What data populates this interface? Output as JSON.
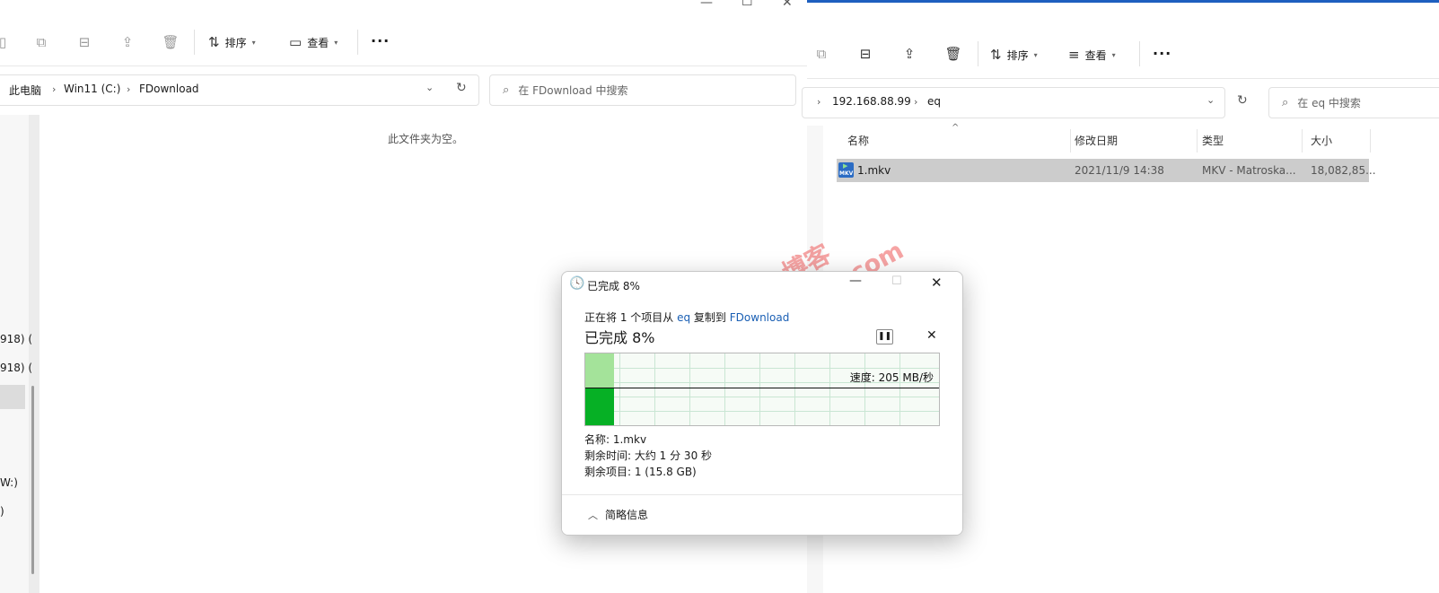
{
  "left_explorer": {
    "toolbar": {
      "sort_label": "排序",
      "view_label": "查看",
      "more_label": "···"
    },
    "address": {
      "segments": [
        "此电脑",
        "Win11 (C:)",
        "FDownload"
      ]
    },
    "search": {
      "placeholder": "在 FDownload 中搜索"
    },
    "empty_message": "此文件夹为空。",
    "nav_fragments": [
      "918) (",
      "918) (",
      "W:)",
      ")"
    ]
  },
  "right_explorer": {
    "toolbar": {
      "sort_label": "排序",
      "view_label": "查看",
      "more_label": "···"
    },
    "address": {
      "segments": [
        "192.168.88.99",
        "eq"
      ]
    },
    "search": {
      "placeholder": "在 eq 中搜索"
    },
    "columns": [
      "名称",
      "修改日期",
      "类型",
      "大小"
    ],
    "files": [
      {
        "name": "1.mkv",
        "modified": "2021/11/9 14:38",
        "type": "MKV - Matroska...",
        "size": "18,082,85...",
        "icon_label": "MKV"
      }
    ]
  },
  "copy_dialog": {
    "title": "已完成 8%",
    "status_prefix": "正在将 1 个项目从",
    "source": "eq",
    "status_middle": "复制到",
    "destination": "FDownload",
    "progress_heading": "已完成 8%",
    "progress_percent": 8,
    "speed_text": "速度: 205 MB/秒",
    "name_line": "名称: 1.mkv",
    "time_left_line": "剩余时间: 大约 1 分 30 秒",
    "items_left_line": "剩余项目: 1 (15.8 GB)",
    "details_toggle_label": "简略信息",
    "accent_color": "#06b025"
  },
  "watermark": {
    "line1": "GXNAS 博客",
    "line2": "https://wp.gxnas.com"
  }
}
